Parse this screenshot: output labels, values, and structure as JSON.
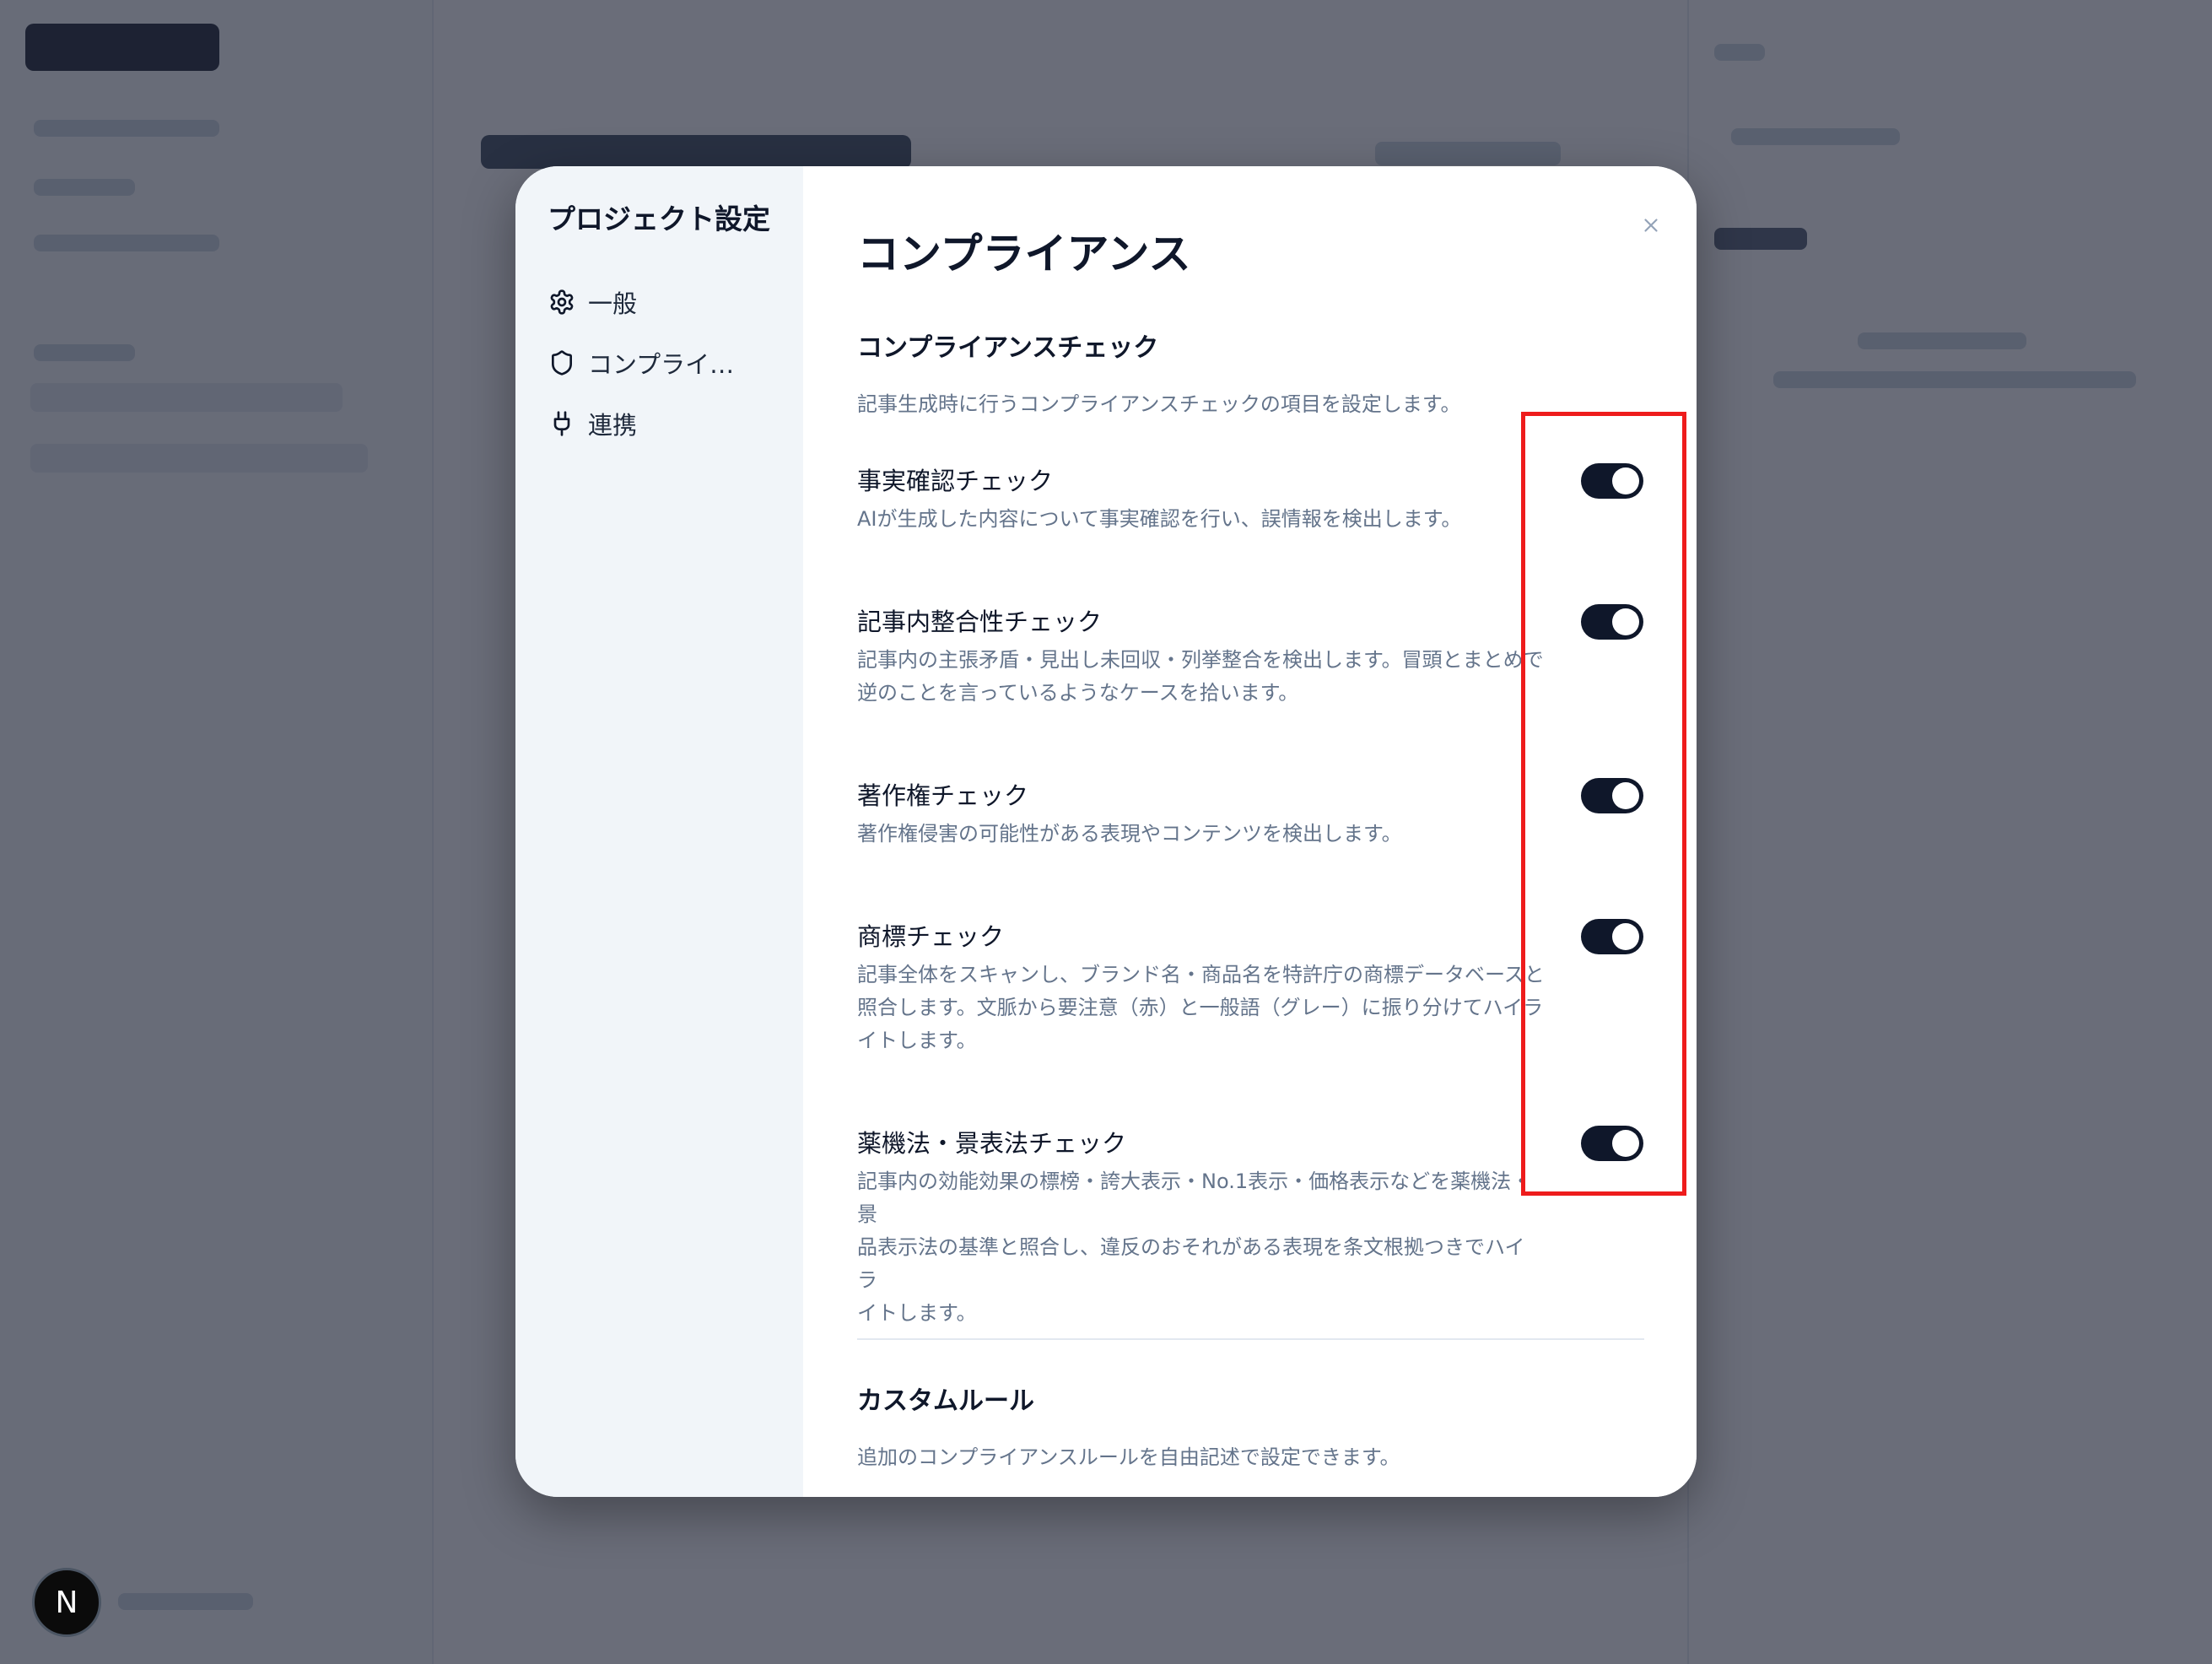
{
  "modal": {
    "nav_title": "プロジェクト設定",
    "nav_items": [
      {
        "label": "一般",
        "icon": "gear-icon"
      },
      {
        "label": "コンプライア...",
        "icon": "shield-icon"
      },
      {
        "label": "連携",
        "icon": "plug-icon"
      }
    ],
    "page_title": "コンプライアンス",
    "compliance_section": {
      "heading": "コンプライアンスチェック",
      "description": "記事生成時に行うコンプライアンスチェックの項目を設定します。"
    },
    "settings": [
      {
        "title": "事実確認チェック",
        "description": "AIが生成した内容について事実確認を行い、誤情報を検出します。",
        "enabled": true
      },
      {
        "title": "記事内整合性チェック",
        "description": "記事内の主張矛盾・見出し未回収・列挙整合を検出します。冒頭とまとめで\n逆のことを言っているようなケースを拾います。",
        "enabled": true
      },
      {
        "title": "著作権チェック",
        "description": "著作権侵害の可能性がある表現やコンテンツを検出します。",
        "enabled": true
      },
      {
        "title": "商標チェック",
        "description": "記事全体をスキャンし、ブランド名・商品名を特許庁の商標データベースと\n照合します。文脈から要注意（赤）と一般語（グレー）に振り分けてハイラ\nイトします。",
        "enabled": true
      },
      {
        "title": "薬機法・景表法チェック",
        "description": "記事内の効能効果の標榜・誇大表示・No.1表示・価格表示などを薬機法・景\n品表示法の基準と照合し、違反のおそれがある表現を条文根拠つきでハイラ\nイトします。",
        "enabled": true
      }
    ],
    "custom_section": {
      "heading": "カスタムルール",
      "description": "追加のコンプライアンスルールを自由記述で設定できます。"
    }
  },
  "badge": {
    "label": "N"
  },
  "colors": {
    "toggle_on": "#0f172a",
    "annotation": "#ee1c1c",
    "overlay": "#23283a"
  }
}
